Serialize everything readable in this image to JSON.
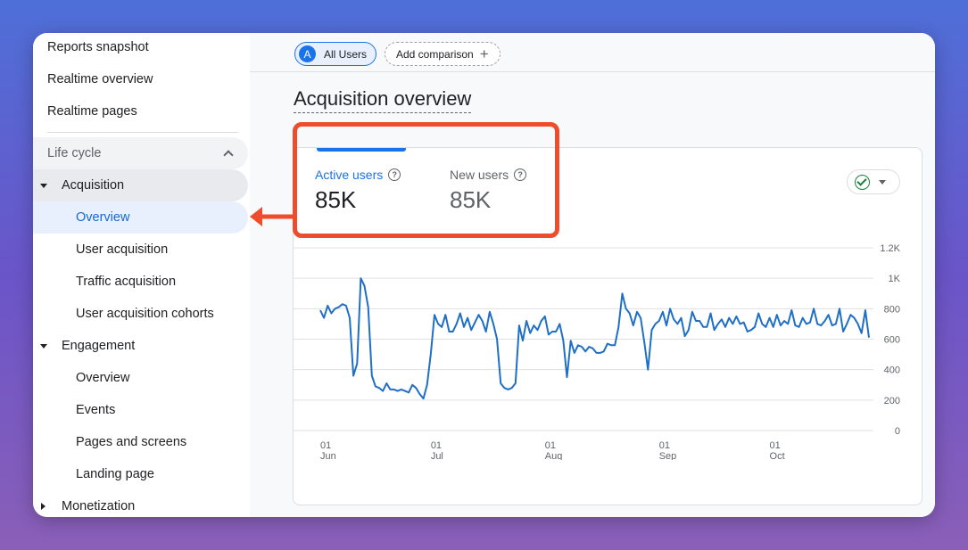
{
  "sidebar": {
    "top_items": [
      "Reports snapshot",
      "Realtime overview",
      "Realtime pages"
    ],
    "lifecycle_label": "Life cycle",
    "acquisition": {
      "label": "Acquisition",
      "items": [
        "Overview",
        "User acquisition",
        "Traffic acquisition",
        "User acquisition cohorts"
      ]
    },
    "engagement": {
      "label": "Engagement",
      "items": [
        "Overview",
        "Events",
        "Pages and screens",
        "Landing page"
      ]
    },
    "monetization_label": "Monetization"
  },
  "topbar": {
    "segment_initial": "A",
    "segment_label": "All Users",
    "add_comparison_label": "Add comparison"
  },
  "page": {
    "title": "Acquisition overview"
  },
  "metrics": {
    "active_users": {
      "label": "Active users",
      "value": "85K"
    },
    "new_users": {
      "label": "New users",
      "value": "85K"
    }
  },
  "colors": {
    "accent": "#1a73e8",
    "highlight": "#ee4d2d",
    "line": "#1f6fc5",
    "check": "#188038"
  },
  "chart_data": {
    "type": "line",
    "ylim": [
      0,
      1200
    ],
    "y_ticks": [
      0,
      200,
      400,
      600,
      800,
      1000,
      1200
    ],
    "y_tick_labels": [
      "0",
      "200",
      "400",
      "600",
      "800",
      "1K",
      "1.2K"
    ],
    "x_ticks": [
      {
        "day": 1,
        "line1": "01",
        "line2": "Jun"
      },
      {
        "day": 31,
        "line1": "01",
        "line2": "Jul"
      },
      {
        "day": 62,
        "line1": "01",
        "line2": "Aug"
      },
      {
        "day": 93,
        "line1": "01",
        "line2": "Sep"
      },
      {
        "day": 123,
        "line1": "01",
        "line2": "Oct"
      }
    ],
    "x_start": "2023-06-01",
    "x_end": "2023-10-30",
    "grid": true,
    "series": [
      {
        "values": [
          790,
          740,
          820,
          770,
          800,
          810,
          830,
          820,
          740,
          360,
          440,
          1000,
          950,
          810,
          360,
          290,
          280,
          260,
          310,
          270,
          270,
          260,
          270,
          260,
          250,
          300,
          280,
          240,
          210,
          300,
          500,
          760,
          700,
          680,
          760,
          650,
          650,
          700,
          770,
          680,
          740,
          660,
          710,
          760,
          720,
          650,
          780,
          700,
          600,
          310,
          280,
          270,
          280,
          310,
          690,
          590,
          720,
          640,
          690,
          660,
          720,
          750,
          630,
          650,
          650,
          700,
          590,
          350,
          590,
          510,
          560,
          550,
          520,
          550,
          540,
          510,
          510,
          520,
          570,
          560,
          560,
          680,
          900,
          800,
          770,
          690,
          780,
          740,
          580,
          400,
          660,
          700,
          720,
          780,
          690,
          800,
          730,
          700,
          740,
          620,
          660,
          780,
          720,
          720,
          680,
          680,
          770,
          660,
          700,
          730,
          680,
          740,
          700,
          750,
          700,
          710,
          650,
          660,
          680,
          770,
          700,
          680,
          740,
          680,
          760,
          690,
          720,
          700,
          790,
          690,
          680,
          740,
          700,
          710,
          800,
          700,
          690,
          720,
          760,
          690,
          700,
          800,
          650,
          700,
          760,
          740,
          700,
          640,
          790,
          610
        ]
      }
    ]
  }
}
